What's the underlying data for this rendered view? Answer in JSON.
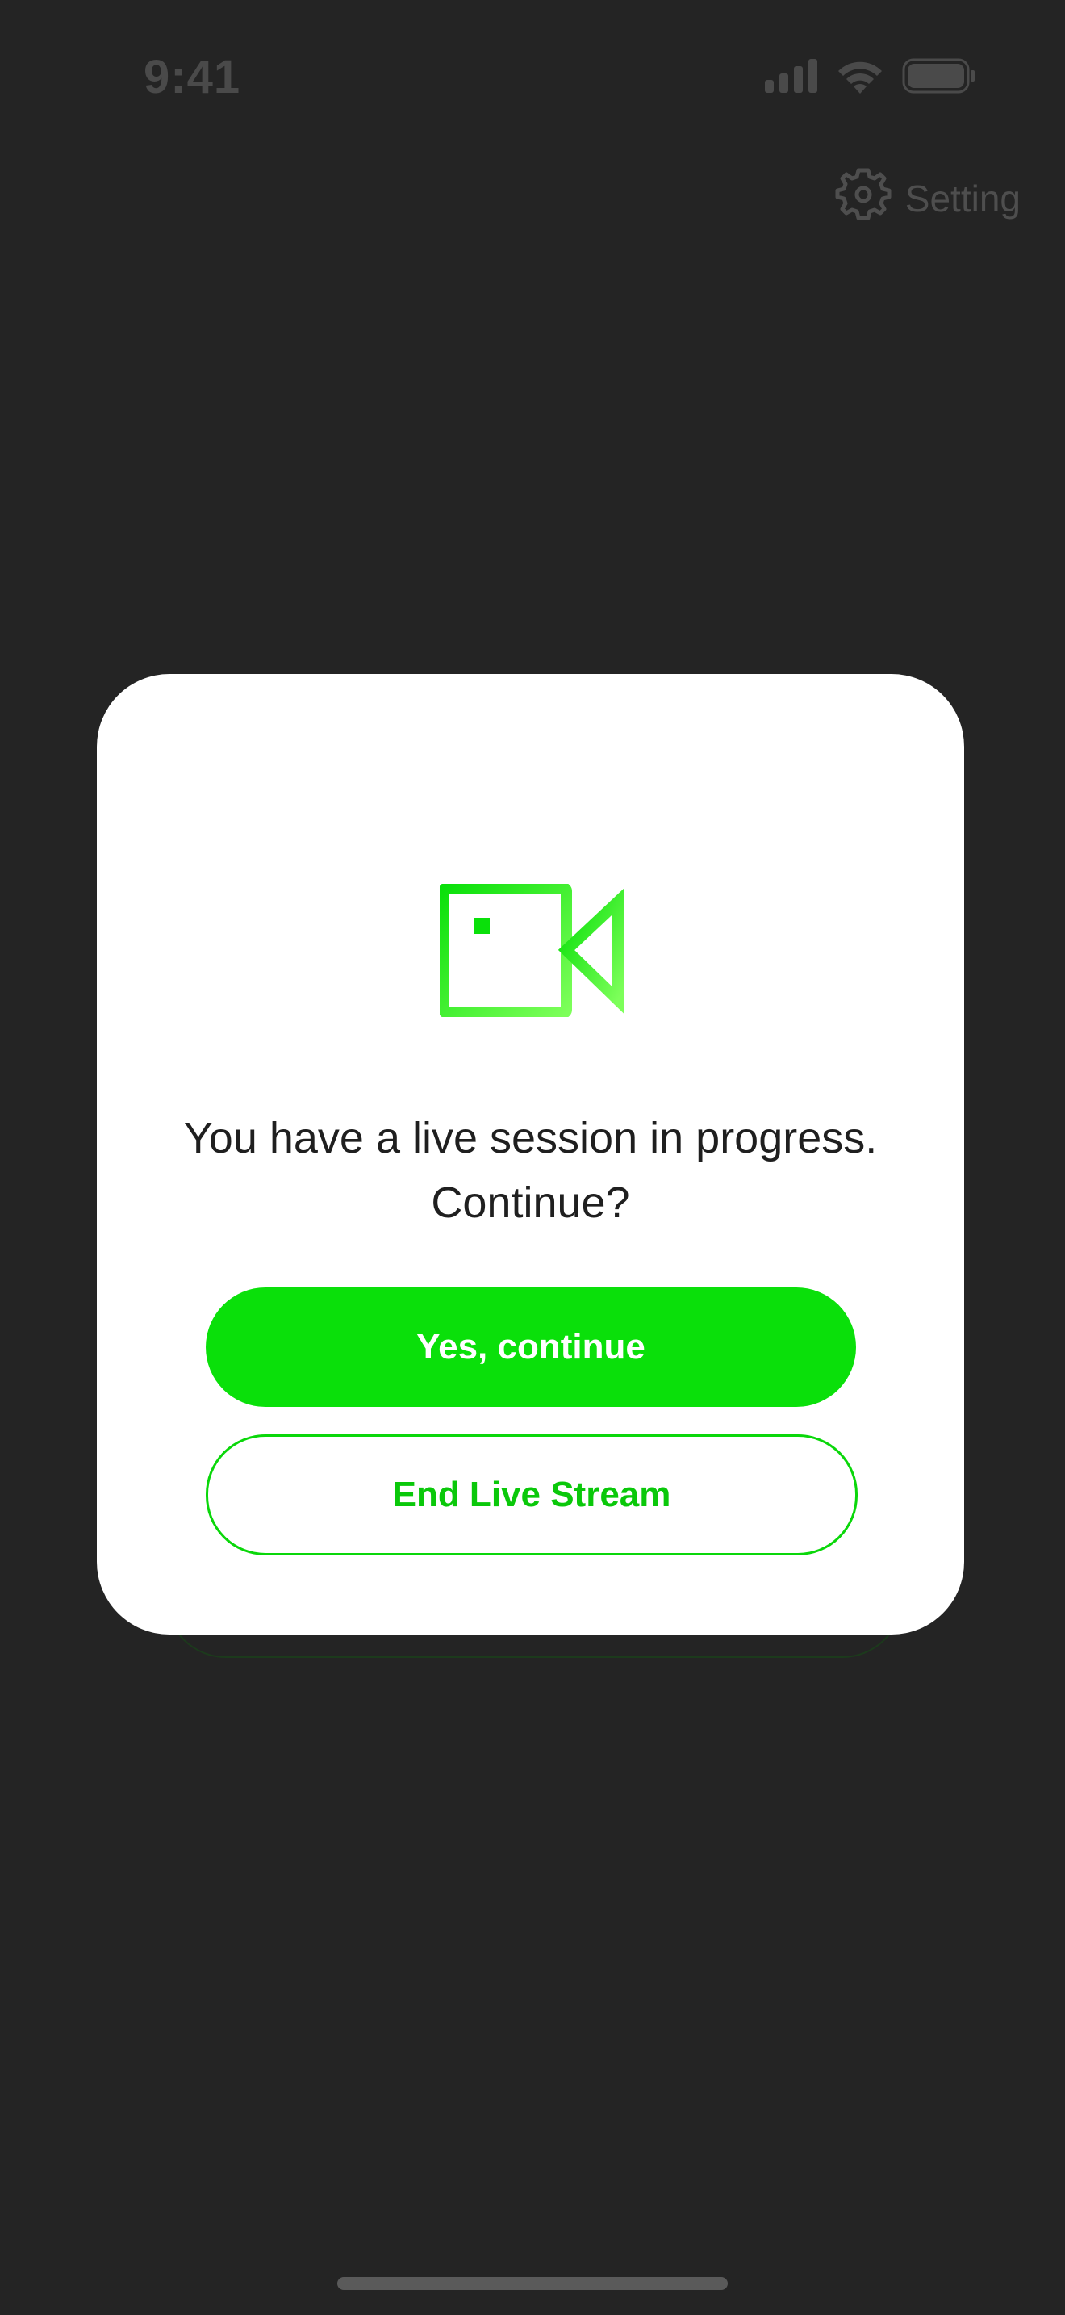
{
  "status_bar": {
    "time": "9:41",
    "signal_icon": "cellular-signal-icon",
    "wifi_icon": "wifi-icon",
    "battery_icon": "battery-icon"
  },
  "header": {
    "setting_label": "Setting",
    "setting_icon": "gear-icon"
  },
  "modal": {
    "icon": "video-camera-icon",
    "message_line1": "You have a live session in progress.",
    "message_line2": "Continue?",
    "continue_label": "Yes, continue",
    "end_label": "End Live Stream"
  },
  "colors": {
    "background": "#242424",
    "accent_green": "#0ae00a",
    "modal_background": "#ffffff",
    "text_dark": "#1f1f1f"
  }
}
